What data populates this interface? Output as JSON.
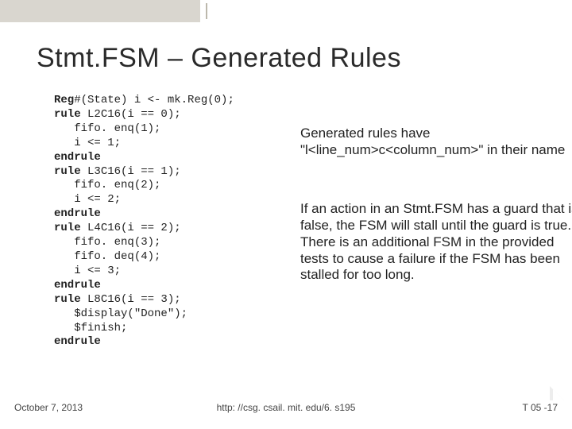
{
  "title": "Stmt.FSM – Generated Rules",
  "code": {
    "l0": {
      "a": "Reg",
      "b": "#(State) i <- mk.Reg(0);"
    },
    "l1": {
      "a": "rule",
      "b": " L2C16(i == 0);"
    },
    "l2": "   fifo. enq(1);",
    "l3": "   i <= 1;",
    "l4": "endrule",
    "l5": {
      "a": "rule",
      "b": " L3C16(i == 1);"
    },
    "l6": "   fifo. enq(2);",
    "l7": "   i <= 2;",
    "l8": "endrule",
    "l9": {
      "a": "rule",
      "b": " L4C16(i == 2);"
    },
    "l10": "   fifo. enq(3);",
    "l11": "   fifo. deq(4);",
    "l12": "   i <= 3;",
    "l13": "endrule",
    "l14": {
      "a": "rule",
      "b": " L8C16(i == 3);"
    },
    "l15": "   $display(\"Done\");",
    "l16": "   $finish;",
    "l17": "endrule"
  },
  "notes": {
    "p1": "Generated rules have \"l<line_num>c<column_num>\" in their name",
    "p2": "If an action in an Stmt.FSM has a guard that is false, the FSM will stall until the guard is true. There is an additional FSM in the provided tests to cause a failure if the FSM has been stalled for too long."
  },
  "footer": {
    "left": "October 7, 2013",
    "center": "http: //csg. csail. mit. edu/6. s195",
    "right": "T 05 -17"
  }
}
